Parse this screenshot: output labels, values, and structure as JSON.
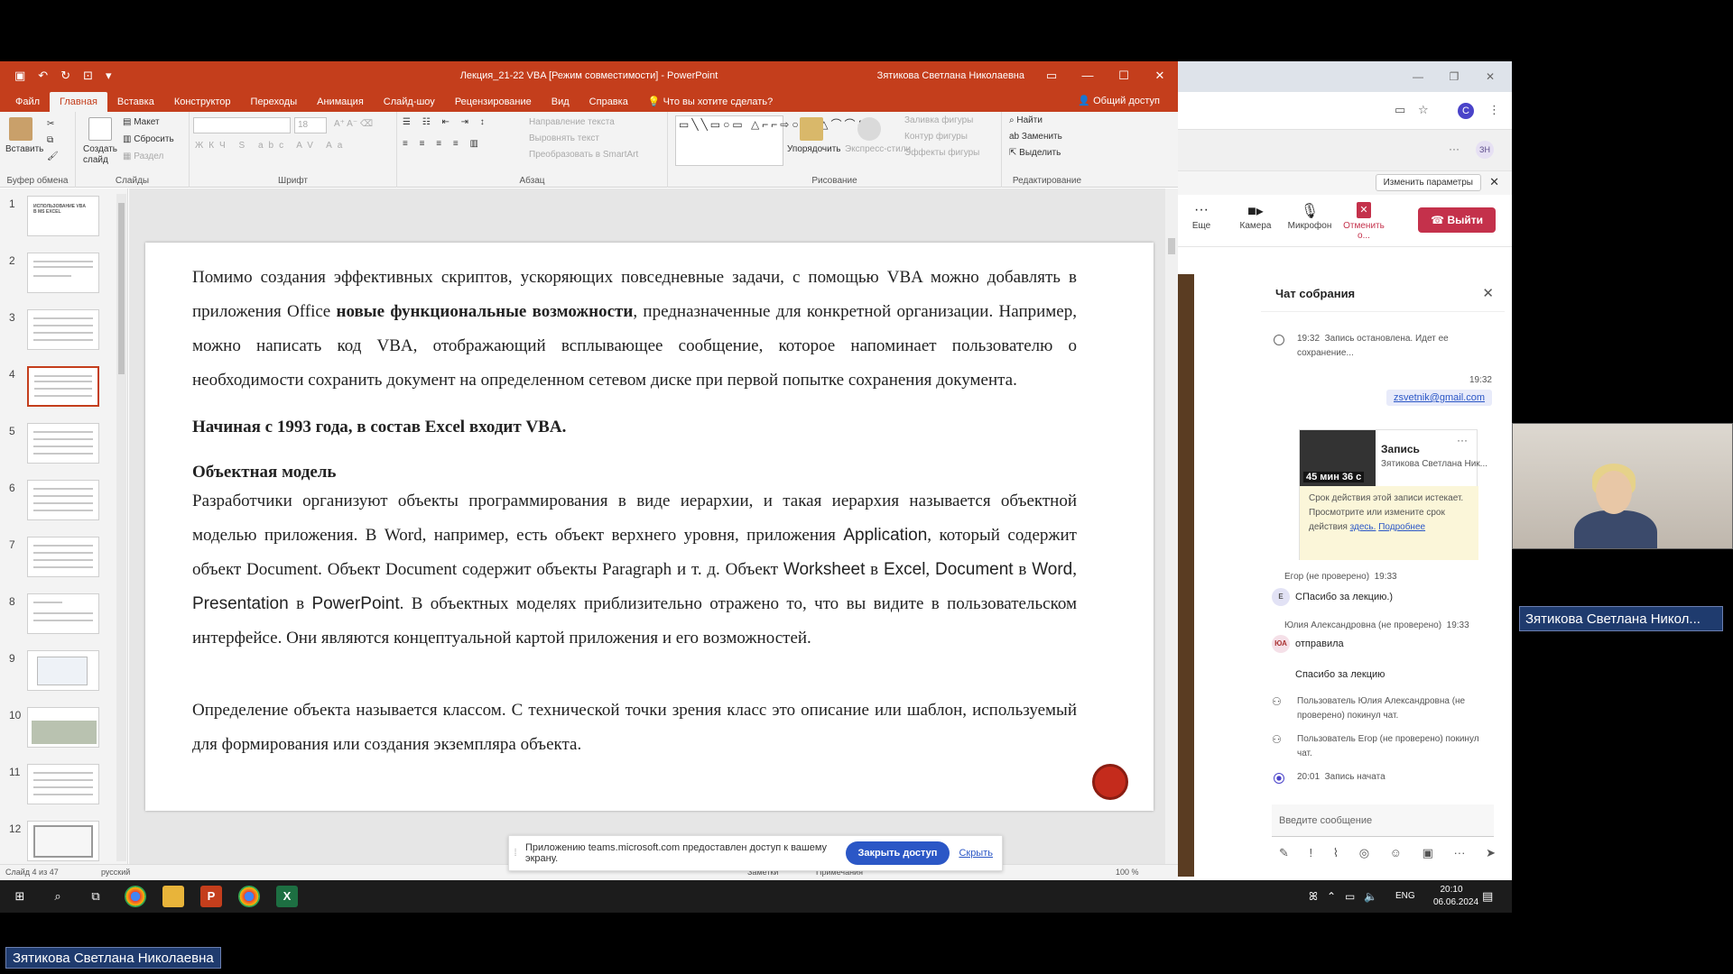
{
  "ppt": {
    "title": "Лекция_21-22 VBA [Режим совместимости]  -  PowerPoint",
    "user": "Зятикова Светлана Николаевна",
    "tabs": [
      "Файл",
      "Главная",
      "Вставка",
      "Конструктор",
      "Переходы",
      "Анимация",
      "Слайд-шоу",
      "Рецензирование",
      "Вид",
      "Справка"
    ],
    "tell_me": "Что вы хотите сделать?",
    "share": "Общий доступ",
    "ribbon": {
      "paste": "Вставить",
      "clipboard": "Буфер обмена",
      "create_slide": "Создать слайд",
      "layout": "Макет",
      "reset": "Сбросить",
      "section": "Раздел",
      "slides": "Слайды",
      "font_size": "18",
      "font": "Шрифт",
      "paragraph": "Абзац",
      "text_direction": "Направление текста",
      "align_text": "Выровнять текст",
      "smartart": "Преобразовать в SmartArt",
      "arrange": "Упорядочить",
      "quick_styles": "Экспресс-стили",
      "shape_fill": "Заливка фигуры",
      "shape_outline": "Контур фигуры",
      "shape_effects": "Эффекты фигуры",
      "drawing": "Рисование",
      "find": "Найти",
      "replace": "Заменить",
      "select": "Выделить",
      "editing": "Редактирование"
    },
    "thumb_numbers": [
      "1",
      "2",
      "3",
      "4",
      "5",
      "6",
      "7",
      "8",
      "9",
      "10",
      "11",
      "12"
    ],
    "thumb1_text": "ИСПОЛЬЗОВАНИЕ VBA В MS EXCEL",
    "slide": {
      "p1_a": "Помимо создания эффективных скриптов, ускоряющих повседневные задачи, с помощью VBA можно добавлять в приложения Office ",
      "p1_bold": "новые функциональные возможности",
      "p1_b": ", предназначенные для конкретной организации. Например, можно написать код VBA, отображающий всплывающее сообщение, которое напоминает пользователю о необходимости сохранить документ на определенном сетевом диске при первой попытке сохранения документа.",
      "heading1": "Начиная с 1993 года, в состав Excel входит VBA.",
      "heading2": "Объектная модель",
      "p2_a": "Разработчики организуют объекты программирования в виде иерархии, и такая иерархия называется объектной моделью приложения. В Word, например, есть объект верхнего уровня,  приложения ",
      "p2_app": "Application",
      "p2_b": ", который содержит объект Document. Объект Document содержит объекты Paragraph и т. д. Объект ",
      "p2_ws": "Worksheet",
      "p2_in1": " в ",
      "p2_excel": "Excel",
      "p2_c1": ", ",
      "p2_doc": "Document",
      "p2_in2": " в ",
      "p2_word": "Word",
      "p2_c2": ", ",
      "p2_pres": "Presentation",
      "p2_in3": " в ",
      "p2_ppt": "PowerPoint",
      "p2_d": ". В объектных моделях приблизительно отражено то, что вы видите в пользовательском интерфейсе. Они являются концептуальной картой приложения и его возможностей.",
      "p3": "Определение объекта называется классом. С технической точки зрения класс это описание или шаблон, используемый для формирования или создания экземпляра объекта."
    },
    "sharebar": {
      "message": "Приложению teams.microsoft.com предоставлен доступ к вашему экрану.",
      "stop": "Закрыть доступ",
      "hide": "Скрыть"
    },
    "status": {
      "slide": "Слайд 4 из 47",
      "lang": "русский",
      "notes": "Заметки",
      "comments": "Примечания",
      "zoom": "100 %"
    }
  },
  "teams": {
    "avatar_letter": "C",
    "zn": "ЗН",
    "change_params": "Изменить параметры",
    "tools": [
      "Еще",
      "Камера",
      "Микрофон",
      "Отменить о..."
    ],
    "leave": "Выйти",
    "chat_title": "Чат собрания",
    "sys1_time": "19:32",
    "sys1_text": "Запись остановлена. Идет ее сохранение...",
    "mine_time": "19:32",
    "mine_email": "zsvetnik@gmail.com",
    "rec_duration": "45 мин 36 с",
    "rec_title": "Запись",
    "rec_owner": "Зятикова Светлана Ник...",
    "rec_note": "Срок действия этой записи истекает. Просмотрите или измените срок действия",
    "rec_note_link1": "здесь.",
    "rec_note_link2": "Подробнее",
    "egor_name": "Егор (не проверено)",
    "egor_time": "19:33",
    "egor_initial": "Е",
    "egor_msg": "СПасибо за лекцию.)",
    "julia_name": "Юлия Александровна (не проверено)",
    "julia_time": "19:33",
    "julia_initials": "ЮА",
    "julia_msg1": "отправила",
    "julia_msg2": "Спасибо за лекцию",
    "left1": "Пользователь Юлия Александровна (не проверено) покинул чат.",
    "left2": "Пользователь Егор (не проверено) покинул чат.",
    "sys2_time": "20:01",
    "sys2_text": "Запись начата",
    "compose_placeholder": "Введите сообщение"
  },
  "presenter_name": "Зятикова Светлана Никол...",
  "taskbar": {
    "lang": "ENG",
    "time": "20:10",
    "date": "06.06.2024"
  },
  "bottom_name": "Зятикова Светлана Николаевна"
}
